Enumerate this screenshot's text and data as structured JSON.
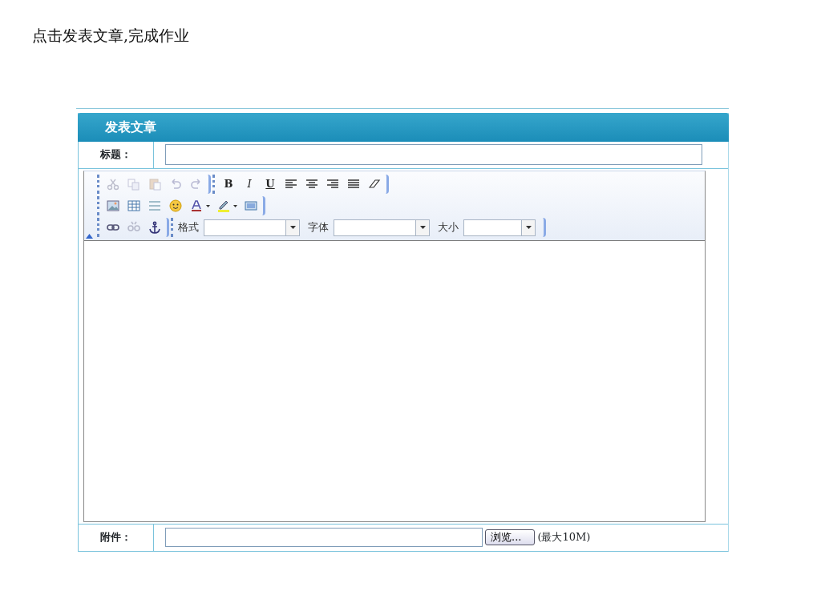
{
  "instruction": "点击发表文章,完成作业",
  "panel": {
    "title": "发表文章"
  },
  "title_field": {
    "label": "标题："
  },
  "toolbar_rows": [
    [
      {
        "kind": "icon",
        "disabled": true
      },
      {
        "kind": "icon",
        "disabled": true
      },
      {
        "kind": "icon",
        "disabled": true
      },
      {
        "kind": "icon",
        "disabled": true
      },
      {
        "kind": "icon",
        "disabled": true
      },
      {
        "kind": "sep"
      },
      {
        "kind": "text",
        "text": "B"
      },
      {
        "kind": "text",
        "text": "I"
      },
      {
        "kind": "text",
        "text": "U"
      },
      {
        "kind": "icon",
        "disabled": false
      },
      {
        "kind": "icon",
        "disabled": false
      },
      {
        "kind": "icon",
        "disabled": false
      },
      {
        "kind": "icon",
        "disabled": false
      },
      {
        "kind": "icon",
        "disabled": false
      }
    ],
    [
      {
        "kind": "icon",
        "disabled": false
      },
      {
        "kind": "icon",
        "disabled": false
      },
      {
        "kind": "icon",
        "disabled": false
      },
      {
        "kind": "icon",
        "disabled": false
      },
      {
        "kind": "icon",
        "disabled": false
      },
      {
        "kind": "icon",
        "disabled": false
      },
      {
        "kind": "icon",
        "disabled": false
      }
    ],
    [
      {
        "kind": "icon",
        "disabled": false
      },
      {
        "kind": "icon",
        "disabled": true
      },
      {
        "kind": "icon",
        "disabled": false
      },
      {
        "kind": "sep"
      },
      {
        "kind": "select",
        "label": "格式"
      },
      {
        "kind": "select",
        "label": "字体"
      },
      {
        "kind": "select",
        "label": "大小"
      }
    ]
  ],
  "attachment": {
    "label": "附件：",
    "browse_button": "浏览...",
    "note": "(最大10M)"
  }
}
